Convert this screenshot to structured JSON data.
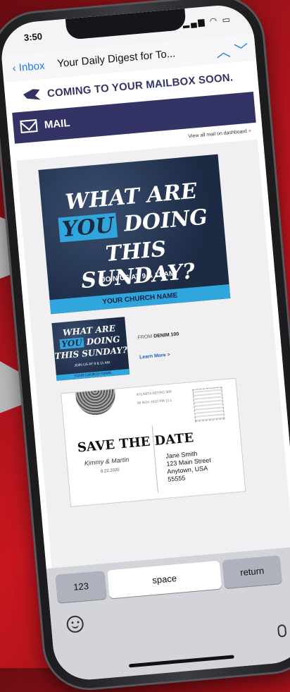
{
  "status": {
    "time": "3:50"
  },
  "mail_header": {
    "back_label": "Inbox",
    "subject": "Your Daily Digest for To...",
    "up_symbol": "︿",
    "down_symbol": "﹀"
  },
  "email": {
    "coming_soon": "COMING TO YOUR MAILBOX SOON.",
    "mail_title": "MAIL",
    "view_all": "View all mail on dashboard",
    "view_all_arrow": ">"
  },
  "mailpiece_1": {
    "line1": "WHAT ARE",
    "you": "YOU",
    "doing": " DOING",
    "line3": "THIS SUNDAY?",
    "join": "JOIN US AT 9 & 11 AM",
    "church": "YOUR CHURCH NAME"
  },
  "mailpiece_2": {
    "from_prefix": "FROM",
    "from_sender": "DENIM 100",
    "learn_more": "Learn More",
    "learn_arrow": ">"
  },
  "postcard": {
    "return_line1": "ATLANTA RETRO 300",
    "return_line2": "06 NOV 2010 PM 11 L",
    "save_the_date": "SAVE THE DATE",
    "names": "Kimmy & Martin",
    "date": "8.22.2020",
    "address_name": "Jane Smith",
    "address_street": "123 Main Street",
    "address_city": "Anytown, USA",
    "address_zip": "55555"
  },
  "keyboard": {
    "key_123": "123",
    "key_space": "space",
    "key_return": "return"
  },
  "colors": {
    "accent_blue": "#1a7ee6",
    "usps_navy": "#333366",
    "card_cyan": "#31a6dd",
    "background_red": "#c8161f"
  }
}
